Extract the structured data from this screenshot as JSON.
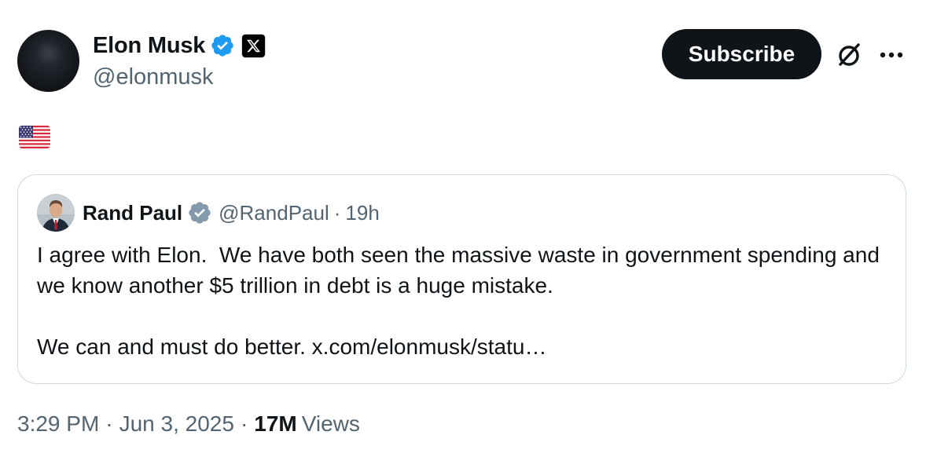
{
  "author": {
    "display_name": "Elon Musk",
    "handle": "@elonmusk",
    "verified": true,
    "affiliation_icon": "x-logo-icon"
  },
  "actions": {
    "subscribe_label": "Subscribe",
    "grok_icon": "grok-icon",
    "more_icon": "more-options-icon"
  },
  "tweet": {
    "text_icon": "us-flag-emoji"
  },
  "quote": {
    "display_name": "Rand Paul",
    "handle": "@RandPaul",
    "separator": "·",
    "time": "19h",
    "paragraph_1": "I agree with Elon.  We have both seen the massive waste in government spending and we know another $5 trillion in debt is a huge mistake.",
    "paragraph_2": "We can and must do better. x.com/elonmusk/statu…"
  },
  "meta": {
    "time": "3:29 PM",
    "separator": "·",
    "date": "Jun 3, 2025",
    "views_count": "17M",
    "views_label": "Views"
  },
  "colors": {
    "verified_blue": "#1d9bf0",
    "verified_gray": "#829aab",
    "text_primary": "#0f1419",
    "text_secondary": "#536471",
    "border": "#cfd9de"
  }
}
